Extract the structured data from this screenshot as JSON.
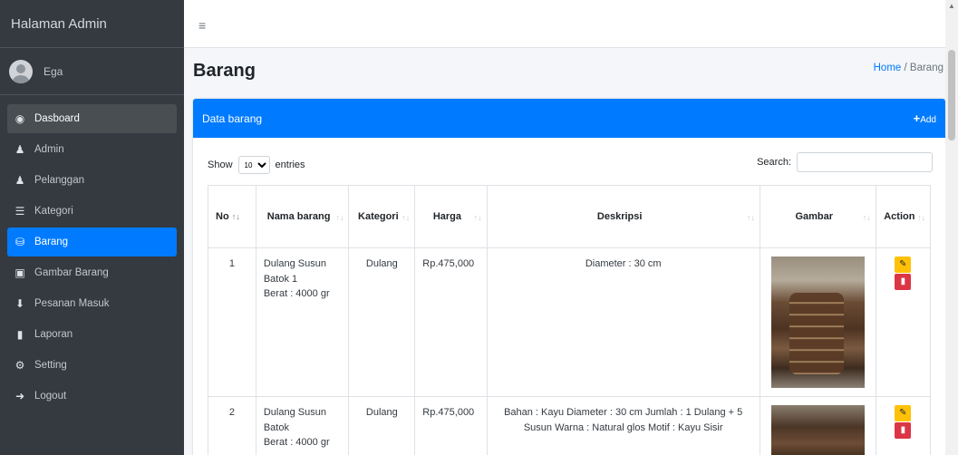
{
  "sidebar": {
    "brand": "Halaman Admin",
    "user_name": "Ega",
    "items": [
      {
        "label": "Dasboard",
        "icon": "dashboard-icon",
        "glyph": "◉"
      },
      {
        "label": "Admin",
        "icon": "user-icon",
        "glyph": "👤"
      },
      {
        "label": "Pelanggan",
        "icon": "users-icon",
        "glyph": "👥"
      },
      {
        "label": "Kategori",
        "icon": "list-icon",
        "glyph": "☰"
      },
      {
        "label": "Barang",
        "icon": "cubes-icon",
        "glyph": "⛁"
      },
      {
        "label": "Gambar Barang",
        "icon": "image-icon",
        "glyph": "▣"
      },
      {
        "label": "Pesanan Masuk",
        "icon": "download-icon",
        "glyph": "⬇"
      },
      {
        "label": "Laporan",
        "icon": "file-icon",
        "glyph": "▮"
      },
      {
        "label": "Setting",
        "icon": "gear-icon",
        "glyph": "⚙"
      },
      {
        "label": "Logout",
        "icon": "logout-icon",
        "glyph": "➜"
      }
    ]
  },
  "topbar": {
    "menu_icon": "hamburger-icon",
    "menu_glyph": "≡"
  },
  "page": {
    "title": "Barang",
    "breadcrumb_home": "Home",
    "breadcrumb_sep": " / ",
    "breadcrumb_current": "Barang"
  },
  "card": {
    "title": "Data barang",
    "add_icon": "+",
    "add_label": "Add"
  },
  "table_controls": {
    "show_label": "Show",
    "entries_value": "10",
    "entries_label": "entries",
    "search_label": "Search:",
    "search_value": ""
  },
  "table": {
    "headers": [
      "No",
      "Nama barang",
      "Kategori",
      "Harga",
      "Deskripsi",
      "Gambar",
      "Action"
    ],
    "rows": [
      {
        "no": "1",
        "nama": "Dulang Susun Batok 1",
        "berat": "Berat : 4000 gr",
        "kategori": "Dulang",
        "harga": "Rp.475,000",
        "deskripsi": "Diameter : 30 cm"
      },
      {
        "no": "2",
        "nama": "Dulang Susun Batok",
        "berat": "Berat : 4000 gr",
        "kategori": "Dulang",
        "harga": "Rp.475,000",
        "deskripsi": "Bahan : Kayu Diameter : 30 cm Jumlah : 1 Dulang + 5 Susun Warna : Natural glos Motif : Kayu Sisir"
      }
    ]
  },
  "colors": {
    "sidebar_bg": "#343a40",
    "accent": "#007bff",
    "edit": "#ffc107",
    "delete": "#dc3545"
  }
}
